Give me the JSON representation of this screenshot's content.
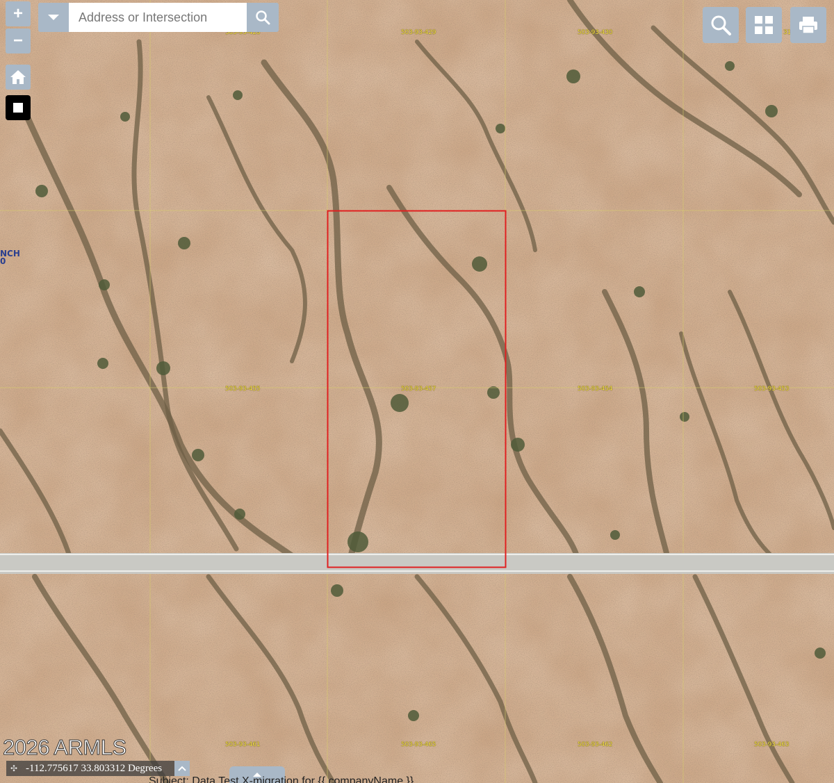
{
  "map": {
    "zoom_in_label": "+",
    "zoom_out_label": "−",
    "search": {
      "placeholder": "Address or Intersection"
    },
    "parcels": [
      "503-93-428",
      "503-93-429",
      "503-93-430",
      "503-93-455",
      "503-93-457",
      "503-93-454",
      "503-93-453",
      "503-93-461",
      "503-93-465",
      "503-93-462",
      "503-93-463"
    ],
    "side_fragment": {
      "line1": "NCH",
      "line2": "0"
    },
    "right_fragment": "31",
    "selected_parcel_color": "#e02020",
    "watermark": "2026 ARMLS",
    "coordinates": "-112.775617 33.803312 Degrees",
    "subject_line": "Subject: Data Test X-migration for {{ companyName }}",
    "tools": [
      "search-tool-icon",
      "layers-grid-icon",
      "print-icon",
      "home-icon",
      "stop-icon"
    ]
  }
}
